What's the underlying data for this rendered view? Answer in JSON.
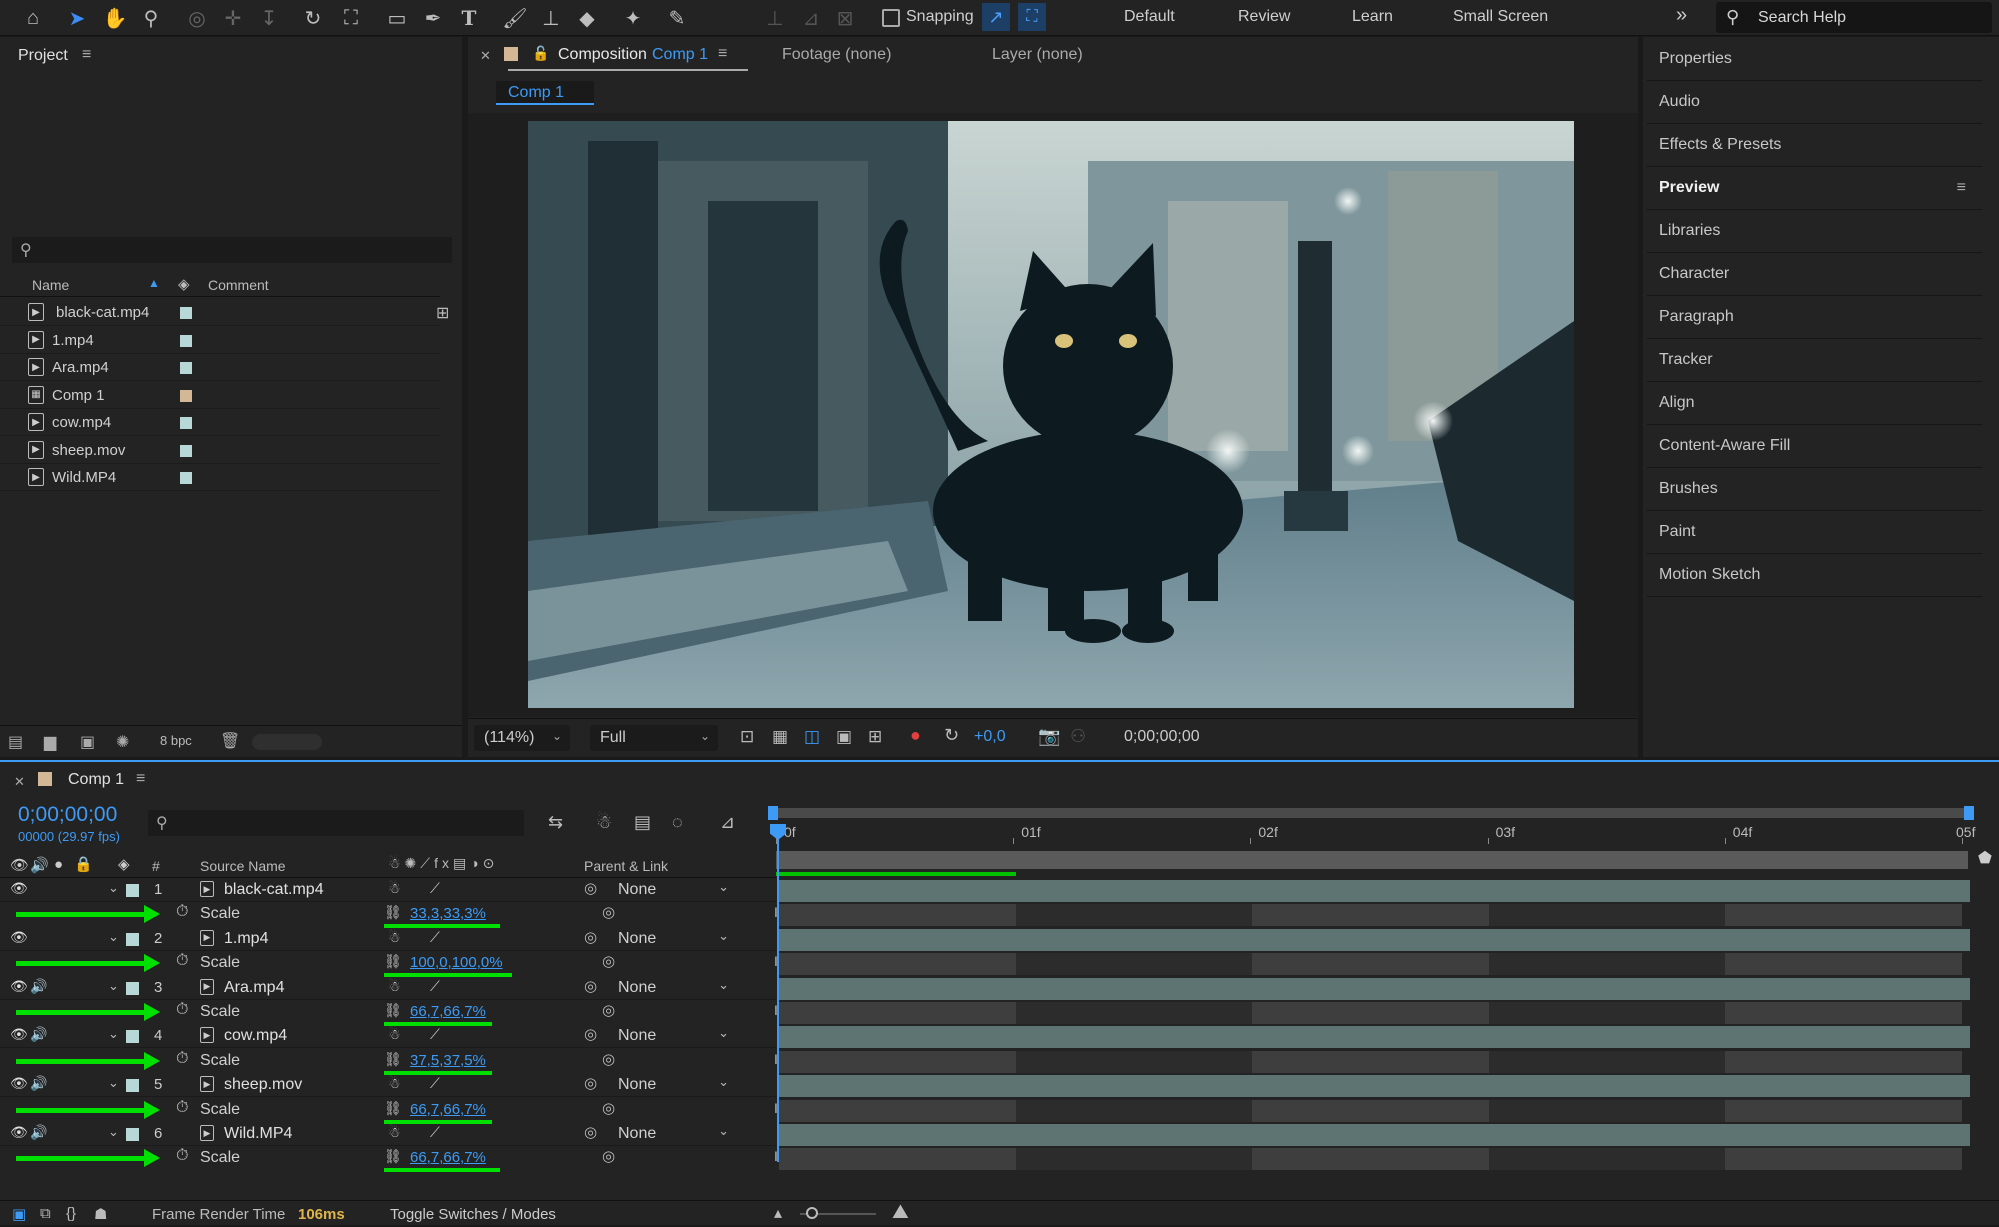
{
  "toolbar": {
    "snapping_label": "Snapping",
    "workspaces": [
      "Default",
      "Review",
      "Learn",
      "Small Screen"
    ],
    "search_placeholder": "Search Help"
  },
  "project": {
    "title": "Project",
    "col_name": "Name",
    "col_comment": "Comment",
    "items": [
      {
        "name": "black-cat.mp4",
        "color": "#b8d8d8"
      },
      {
        "name": "1.mp4",
        "color": "#b8d8d8"
      },
      {
        "name": "Ara.mp4",
        "color": "#b8d8d8"
      },
      {
        "name": "Comp 1",
        "color": "#d4b896"
      },
      {
        "name": "cow.mp4",
        "color": "#b8d8d8"
      },
      {
        "name": "sheep.mov",
        "color": "#b8d8d8"
      },
      {
        "name": "Wild.MP4",
        "color": "#b8d8d8"
      }
    ],
    "bpc": "8 bpc"
  },
  "viewer_tabs": {
    "composition_label": "Composition",
    "composition_name": "Comp 1",
    "footage": "Footage (none)",
    "layer": "Layer (none)",
    "subtab": "Comp 1"
  },
  "viewer_controls": {
    "zoom": "(114%)",
    "resolution": "Full",
    "exposure": "+0,0",
    "timecode": "0;00;00;00"
  },
  "right_panel": [
    "Properties",
    "Audio",
    "Effects & Presets",
    "Preview",
    "Libraries",
    "Character",
    "Paragraph",
    "Tracker",
    "Align",
    "Content-Aware Fill",
    "Brushes",
    "Paint",
    "Motion Sketch"
  ],
  "timeline": {
    "comp_name": "Comp 1",
    "timecode": "0;00;00;00",
    "frame_info": "00000 (29.97 fps)",
    "col_num": "#",
    "col_source": "Source Name",
    "col_parent": "Parent & Link",
    "ruler": [
      "0f",
      "01f",
      "02f",
      "03f",
      "04f",
      "05f"
    ],
    "layers": [
      {
        "num": "1",
        "name": "black-cat.mp4",
        "parent": "None",
        "scale": "33,3,33,3%",
        "audio": false
      },
      {
        "num": "2",
        "name": "1.mp4",
        "parent": "None",
        "scale": "100,0,100,0%",
        "audio": false
      },
      {
        "num": "3",
        "name": "Ara.mp4",
        "parent": "None",
        "scale": "66,7,66,7%",
        "audio": true
      },
      {
        "num": "4",
        "name": "cow.mp4",
        "parent": "None",
        "scale": "37,5,37,5%",
        "audio": true
      },
      {
        "num": "5",
        "name": "sheep.mov",
        "parent": "None",
        "scale": "66,7,66,7%",
        "audio": true
      },
      {
        "num": "6",
        "name": "Wild.MP4",
        "parent": "None",
        "scale": "66,7,66,7%",
        "audio": true
      }
    ],
    "scale_label": "Scale",
    "footer_render_label": "Frame Render Time",
    "footer_render_value": "106ms",
    "footer_toggle": "Toggle Switches / Modes"
  }
}
